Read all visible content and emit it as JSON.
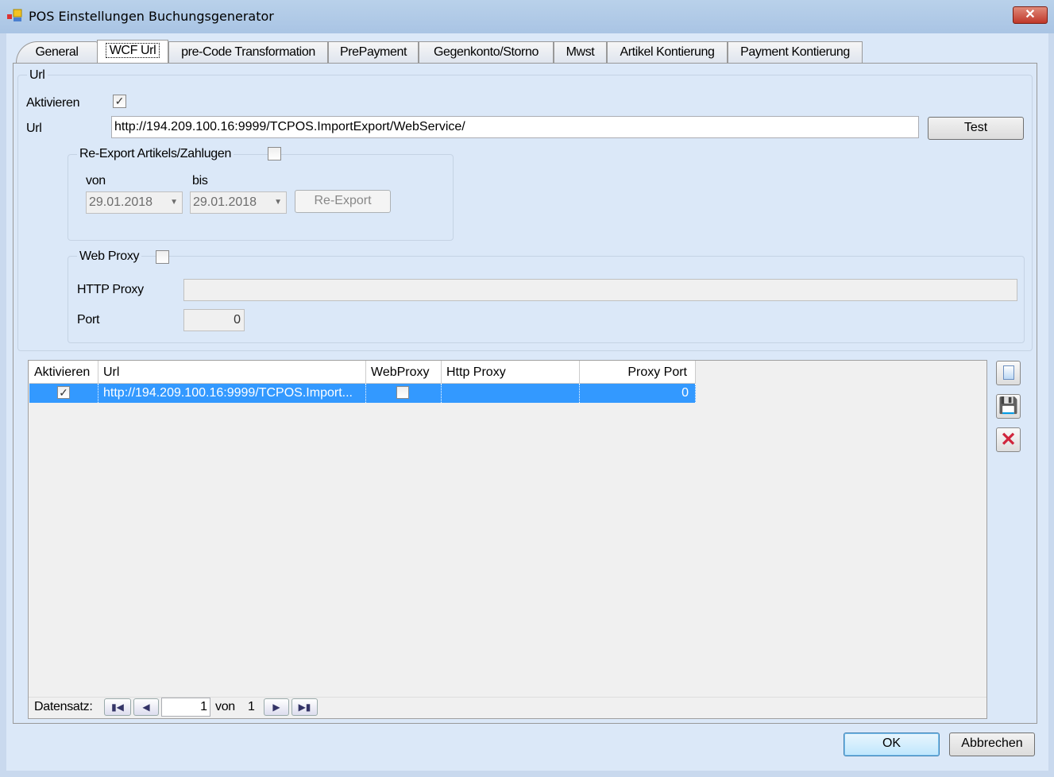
{
  "window": {
    "title": "POS Einstellungen Buchungsgenerator",
    "close": "✕"
  },
  "tabs": [
    "General",
    "WCF Url",
    "pre-Code Transformation",
    "PrePayment",
    "Gegenkonto/Storno",
    "Mwst",
    "Artikel Kontierung",
    "Payment Kontierung"
  ],
  "url_group": {
    "title": "Url",
    "aktivieren_label": "Aktivieren",
    "aktivieren_checked": true,
    "url_label": "Url",
    "url_value": "http://194.209.100.16:9999/TCPOS.ImportExport/WebService/",
    "test_button": "Test"
  },
  "reexport": {
    "title": "Re-Export Artikels/Zahlugen",
    "checked": false,
    "von_label": "von",
    "bis_label": "bis",
    "von_value": "29.01.2018",
    "bis_value": "29.01.2018",
    "button": "Re-Export"
  },
  "proxy": {
    "title": "Web Proxy",
    "checked": false,
    "http_label": "HTTP Proxy",
    "http_value": "",
    "port_label": "Port",
    "port_value": "0"
  },
  "grid": {
    "columns": [
      "Aktivieren",
      "Url",
      "WebProxy",
      "Http Proxy",
      "Proxy Port"
    ],
    "rows": [
      {
        "aktivieren": true,
        "url": "http://194.209.100.16:9999/TCPOS.Import...",
        "webproxy": false,
        "http_proxy": "",
        "proxy_port": "0"
      }
    ]
  },
  "navigator": {
    "label": "Datensatz:",
    "position": "1",
    "of_label": "von",
    "total": "1"
  },
  "buttons": {
    "ok": "OK",
    "cancel": "Abbrechen"
  }
}
